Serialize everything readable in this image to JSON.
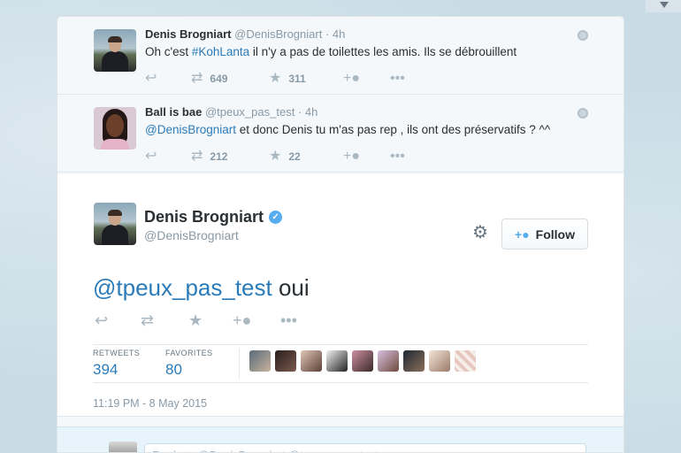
{
  "colors": {
    "link": "#2b7bb9",
    "verified": "#55acee",
    "background": "#c9dce6"
  },
  "tweets": [
    {
      "name": "Denis Brogniart",
      "handle": "@DenisBrogniart",
      "sep": "·",
      "time": "4h",
      "text_pre": "Oh c'est ",
      "text_link": "#KohLanta",
      "text_post": " il n'y a pas de toilettes les amis. Ils se débrouillent",
      "retweets": "649",
      "favorites": "311"
    },
    {
      "name": "Ball is bae",
      "handle": "@tpeux_pas_test",
      "sep": "·",
      "time": "4h",
      "text_pre": "",
      "text_link": "@DenisBrogniart",
      "text_post": " et donc Denis tu m'as pas rep , ils ont des préservatifs ? ^^",
      "retweets": "212",
      "favorites": "22"
    }
  ],
  "main": {
    "name": "Denis Brogniart",
    "handle": "@DenisBrogniart",
    "follow_label": "Follow",
    "text_link": "@tpeux_pas_test",
    "text_post": " oui",
    "retweets_label": "RETWEETS",
    "retweets": "394",
    "favorites_label": "FAVORITES",
    "favorites": "80",
    "timestamp": "11:19 PM - 8 May 2015"
  },
  "reply": {
    "placeholder": "Reply to @DenisBrogniart @tpeux_pas_test"
  },
  "icons": {
    "reply": "reply-icon",
    "retweet": "retweet-icon",
    "favorite": "star-icon",
    "follow": "follow-icon",
    "more": "more-icon",
    "gear": "gear-icon",
    "globe": "globe-icon",
    "verified": "verified-icon"
  }
}
